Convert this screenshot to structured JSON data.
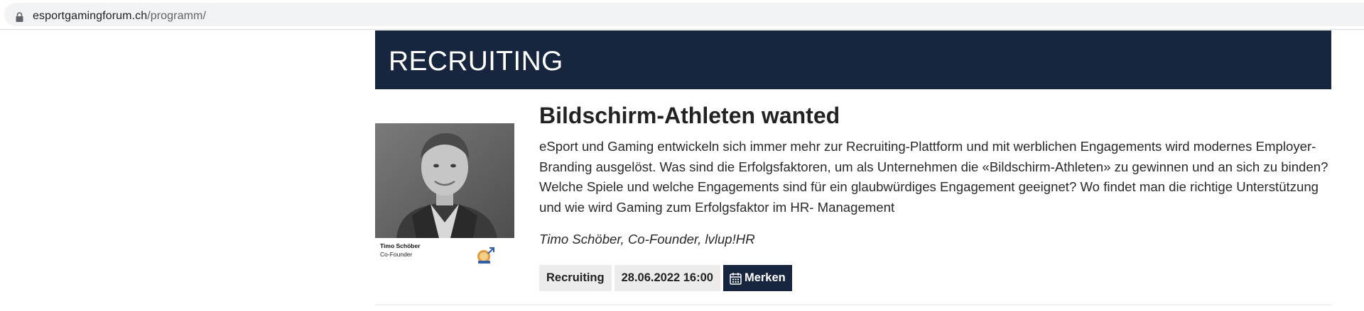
{
  "browser": {
    "url_domain": "esportgamingforum.ch",
    "url_path": "/programm/"
  },
  "section": {
    "heading": "RECRUITING"
  },
  "session": {
    "title": "Bildschirm-Athleten wanted",
    "description": "eSport und Gaming entwickeln sich immer mehr zur Recruiting-Plattform und mit werblichen Engagements wird modernes Employer-Branding ausgelöst. Was sind die Erfolgsfaktoren, um als Unternehmen die «Bildschirm-Athleten» zu gewinnen und an sich zu binden? Welche Spiele und welche Engagements sind für ein glaubwürdiges Engagement geeignet? Wo findet man die richtige Unterstützung und wie wird Gaming zum Erfolgsfaktor im HR- Management",
    "speaker": "Timo Schöber, Co-Founder, lvlup!HR",
    "photo_caption": {
      "name": "Timo Schöber",
      "role": "Co-Founder"
    },
    "tags": {
      "category": "Recruiting",
      "datetime": "28.06.2022 16:00",
      "bookmark_label": "Merken"
    }
  },
  "colors": {
    "banner_bg": "#18253f",
    "tag_bg": "#ececec"
  },
  "icons": {
    "lock": "lock-icon",
    "calendar": "calendar-icon",
    "logo": "lvlup-logo-icon"
  }
}
